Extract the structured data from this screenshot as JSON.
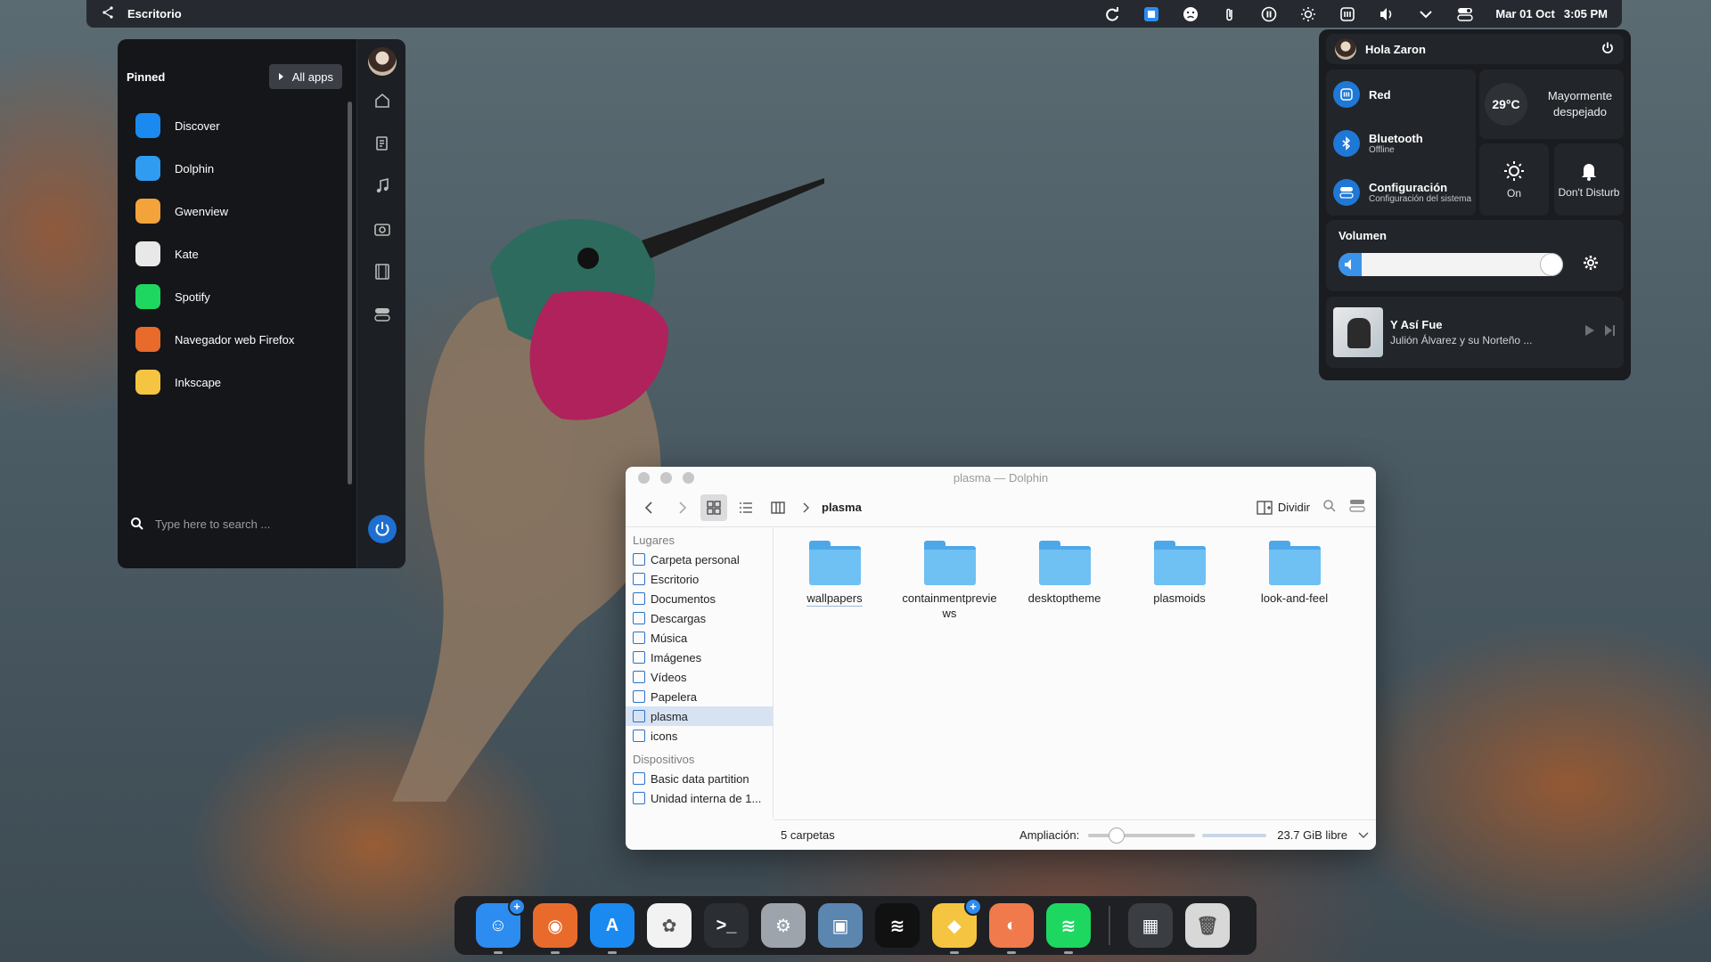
{
  "topbar": {
    "workspace": "Escritorio",
    "clock": {
      "date": "Mar 01 Oct",
      "time": "3:05 PM"
    },
    "tray_icons": [
      "refresh-icon",
      "blue-app-icon",
      "face-icon",
      "paperclip-icon",
      "pause-icon",
      "brightness-icon",
      "network-icon",
      "volume-icon",
      "chevron-down-icon",
      "controls-icon"
    ]
  },
  "launcher": {
    "pinned_label": "Pinned",
    "all_apps_label": "All apps",
    "apps": [
      {
        "label": "Discover",
        "icon": "discover-icon",
        "color": "#1b8af0"
      },
      {
        "label": "Dolphin",
        "icon": "dolphin-icon",
        "color": "#2f9cf1"
      },
      {
        "label": "Gwenview",
        "icon": "gwenview-icon",
        "color": "#f2a33a"
      },
      {
        "label": "Kate",
        "icon": "kate-icon",
        "color": "#e8e8e8"
      },
      {
        "label": "Spotify",
        "icon": "spotify-icon",
        "color": "#1ed760"
      },
      {
        "label": "Navegador web Firefox",
        "icon": "firefox-icon",
        "color": "#e96b2c"
      },
      {
        "label": "Inkscape",
        "icon": "inkscape-icon",
        "color": "#f5c542"
      }
    ],
    "search_placeholder": "Type here to search ..."
  },
  "quick_settings": {
    "greeting": "Hola Zaron",
    "network": {
      "label": "Red"
    },
    "bluetooth": {
      "label": "Bluetooth",
      "status": "Offline"
    },
    "settings": {
      "label": "Configuración",
      "sub": "Configuración del sistema"
    },
    "weather": {
      "temp": "29°C",
      "desc": "Mayormente despejado"
    },
    "brightness_tile": {
      "label": "On"
    },
    "dnd_tile": {
      "label": "Don't Disturb"
    },
    "volume": {
      "title": "Volumen",
      "level": 0.95
    },
    "media": {
      "title": "Y Así Fue",
      "artist": "Julión Álvarez y su Norteño ..."
    }
  },
  "dolphin": {
    "window_title": "plasma — Dolphin",
    "breadcrumb": "plasma",
    "split_label": "Dividir",
    "places_section": "Lugares",
    "places": [
      {
        "label": "Carpeta personal",
        "selected": false
      },
      {
        "label": "Escritorio",
        "selected": false
      },
      {
        "label": "Documentos",
        "selected": false
      },
      {
        "label": "Descargas",
        "selected": false
      },
      {
        "label": "Música",
        "selected": false
      },
      {
        "label": "Imágenes",
        "selected": false
      },
      {
        "label": "Vídeos",
        "selected": false
      },
      {
        "label": "Papelera",
        "selected": false
      },
      {
        "label": "plasma",
        "selected": true
      },
      {
        "label": "icons",
        "selected": false
      }
    ],
    "devices_section": "Dispositivos",
    "devices": [
      {
        "label": "Basic data partition"
      },
      {
        "label": "Unidad interna de 1..."
      }
    ],
    "folders": [
      {
        "name": "wallpapers"
      },
      {
        "name": "containmentpreviews"
      },
      {
        "name": "desktoptheme"
      },
      {
        "name": "plasmoids"
      },
      {
        "name": "look-and-feel"
      }
    ],
    "status": "5 carpetas",
    "zoom_label": "Ampliación:",
    "zoom_level": 0.22,
    "free_space": "23.7 GiB libre"
  },
  "dock": {
    "apps": [
      {
        "name": "finder-icon",
        "color": "#2d8cf0",
        "glyph": "☺",
        "dot": true,
        "badge": true
      },
      {
        "name": "firefox-icon",
        "color": "#e96b2c",
        "glyph": "◉",
        "dot": true,
        "badge": false
      },
      {
        "name": "appstore-icon",
        "color": "#1b8af0",
        "glyph": "A",
        "dot": true,
        "badge": false
      },
      {
        "name": "photos-icon",
        "color": "#f2f2f2",
        "glyph": "✿",
        "dot": false,
        "badge": false
      },
      {
        "name": "terminal-icon",
        "color": "#2b2e33",
        "glyph": ">_",
        "dot": false,
        "badge": false
      },
      {
        "name": "settings-icon",
        "color": "#9ea4ab",
        "glyph": "⚙",
        "dot": false,
        "badge": false
      },
      {
        "name": "screenshot-icon",
        "color": "#5b86b0",
        "glyph": "▣",
        "dot": false,
        "badge": false
      },
      {
        "name": "spotify-icon",
        "color": "#111111",
        "glyph": "≋",
        "dot": false,
        "badge": false
      },
      {
        "name": "sketch-icon",
        "color": "#f5c542",
        "glyph": "◆",
        "dot": true,
        "badge": true
      },
      {
        "name": "preview-icon",
        "color": "#f07a4b",
        "glyph": "◐",
        "dot": true,
        "badge": false
      },
      {
        "name": "spotify-green-icon",
        "color": "#1ed760",
        "glyph": "≋",
        "dot": true,
        "badge": false
      }
    ],
    "pinned_right": [
      {
        "name": "calculator-icon",
        "color": "#3a3d42",
        "glyph": "▦"
      },
      {
        "name": "trash-icon",
        "color": "#d8d8d8",
        "glyph": "🗑"
      }
    ]
  }
}
